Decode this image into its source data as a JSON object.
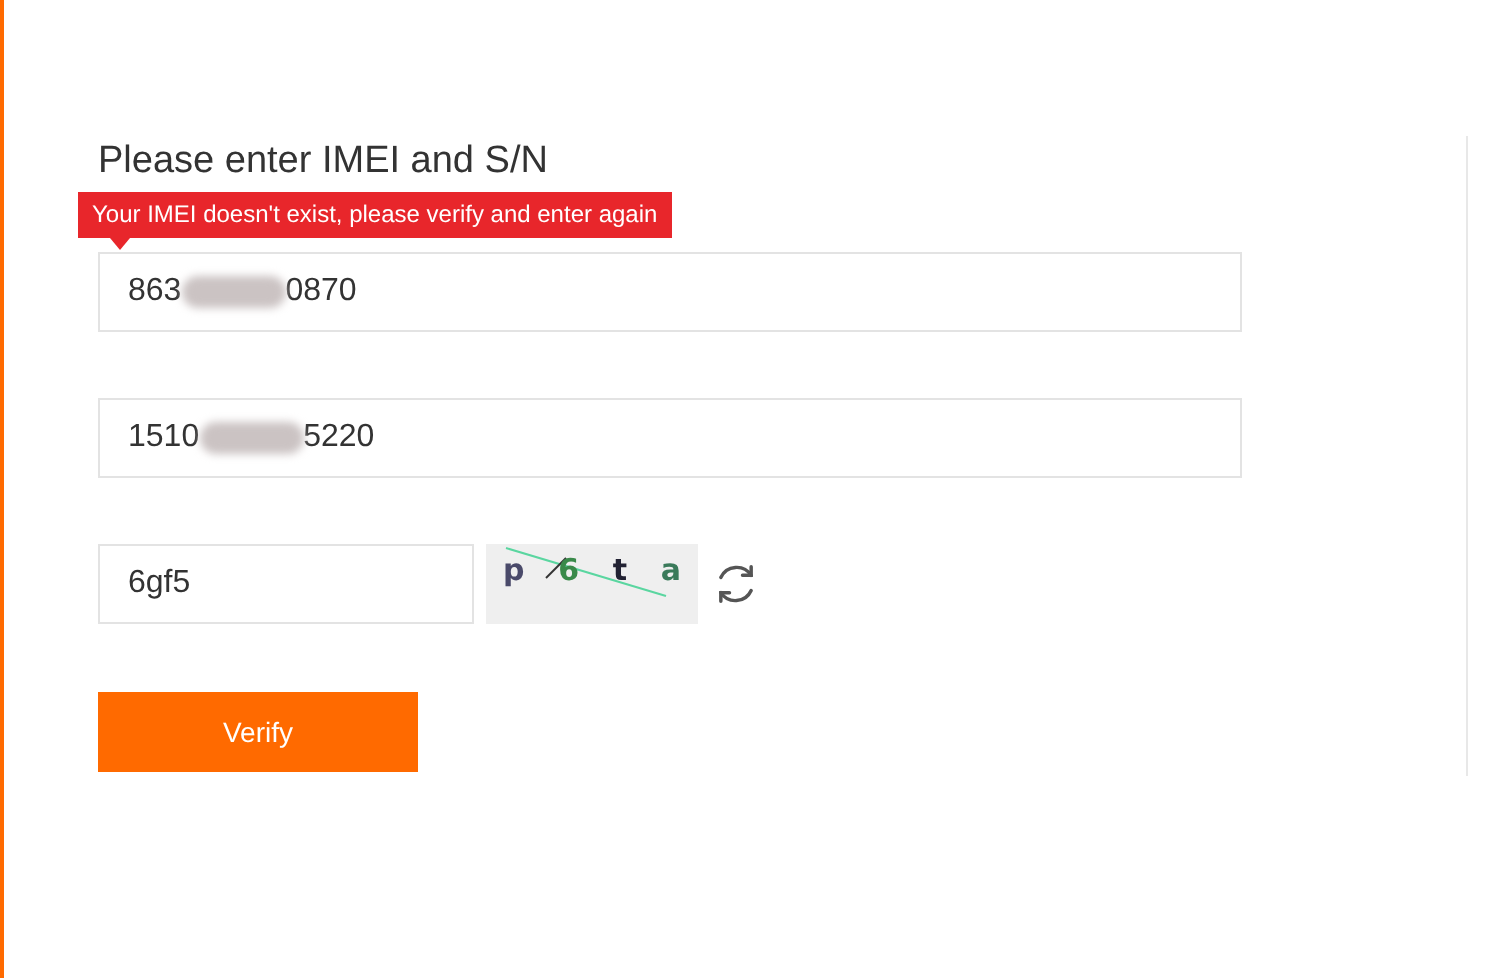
{
  "heading": "Please enter IMEI and S/N",
  "error_tooltip": "Your IMEI doesn't exist, please verify and enter again",
  "fields": [
    {
      "kind": "masked",
      "value_start": "863",
      "value_end": "0870"
    },
    {
      "kind": "masked",
      "value_start": "1510",
      "value_end": "5220"
    }
  ],
  "captcha_field": {
    "value": "6gf5"
  },
  "captcha": {
    "characters": [
      {
        "char": "p",
        "color": "#4a4a6a"
      },
      {
        "char": "6",
        "color": "#3a8a4a"
      },
      {
        "char": "t",
        "color": "#222233"
      },
      {
        "char": "a",
        "color": "#3a7a5a"
      }
    ]
  },
  "verify_button": "Verify"
}
